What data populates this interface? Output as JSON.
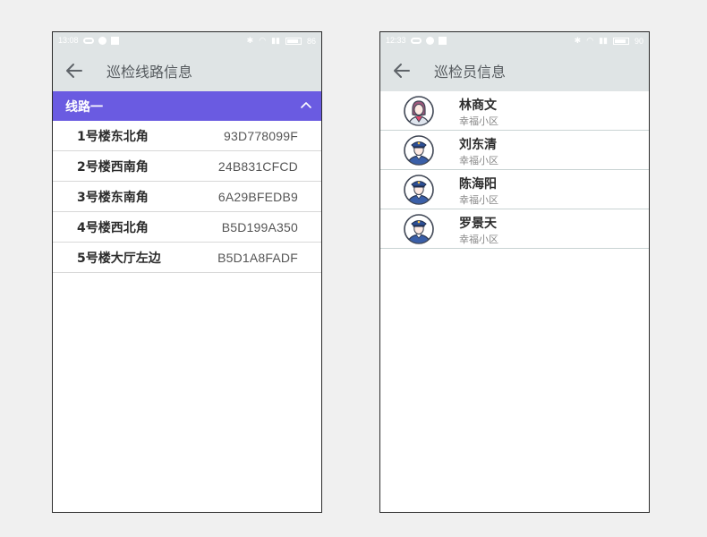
{
  "screen_left": {
    "status": {
      "time": "13:08",
      "battery": "86"
    },
    "title": "巡检线路信息",
    "group": {
      "label": "线路一"
    },
    "routes": [
      {
        "name": "1号楼东北角",
        "code": "93D778099F"
      },
      {
        "name": "2号楼西南角",
        "code": "24B831CFCD"
      },
      {
        "name": "3号楼东南角",
        "code": "6A29BFEDB9"
      },
      {
        "name": "4号楼西北角",
        "code": "B5D199A350"
      },
      {
        "name": "5号楼大厅左边",
        "code": "B5D1A8FADF"
      }
    ]
  },
  "screen_right": {
    "status": {
      "time": "12:33",
      "battery": "90"
    },
    "title": "巡检员信息",
    "people": [
      {
        "name": "林商文",
        "community": "幸福小区",
        "avatar": "female-staff-icon"
      },
      {
        "name": "刘东清",
        "community": "幸福小区",
        "avatar": "police-officer-icon"
      },
      {
        "name": "陈海阳",
        "community": "幸福小区",
        "avatar": "police-officer-icon"
      },
      {
        "name": "罗景天",
        "community": "幸福小区",
        "avatar": "police-officer-icon"
      }
    ]
  },
  "colors": {
    "background": "#f0f0f0",
    "appbar": "#dfe4e5",
    "accent": "#6a5be1",
    "divider": "#d8d8d8",
    "text": "#2b2b2b"
  },
  "icons": {
    "back": "arrow-left-icon",
    "collapse": "chevron-up-icon"
  }
}
